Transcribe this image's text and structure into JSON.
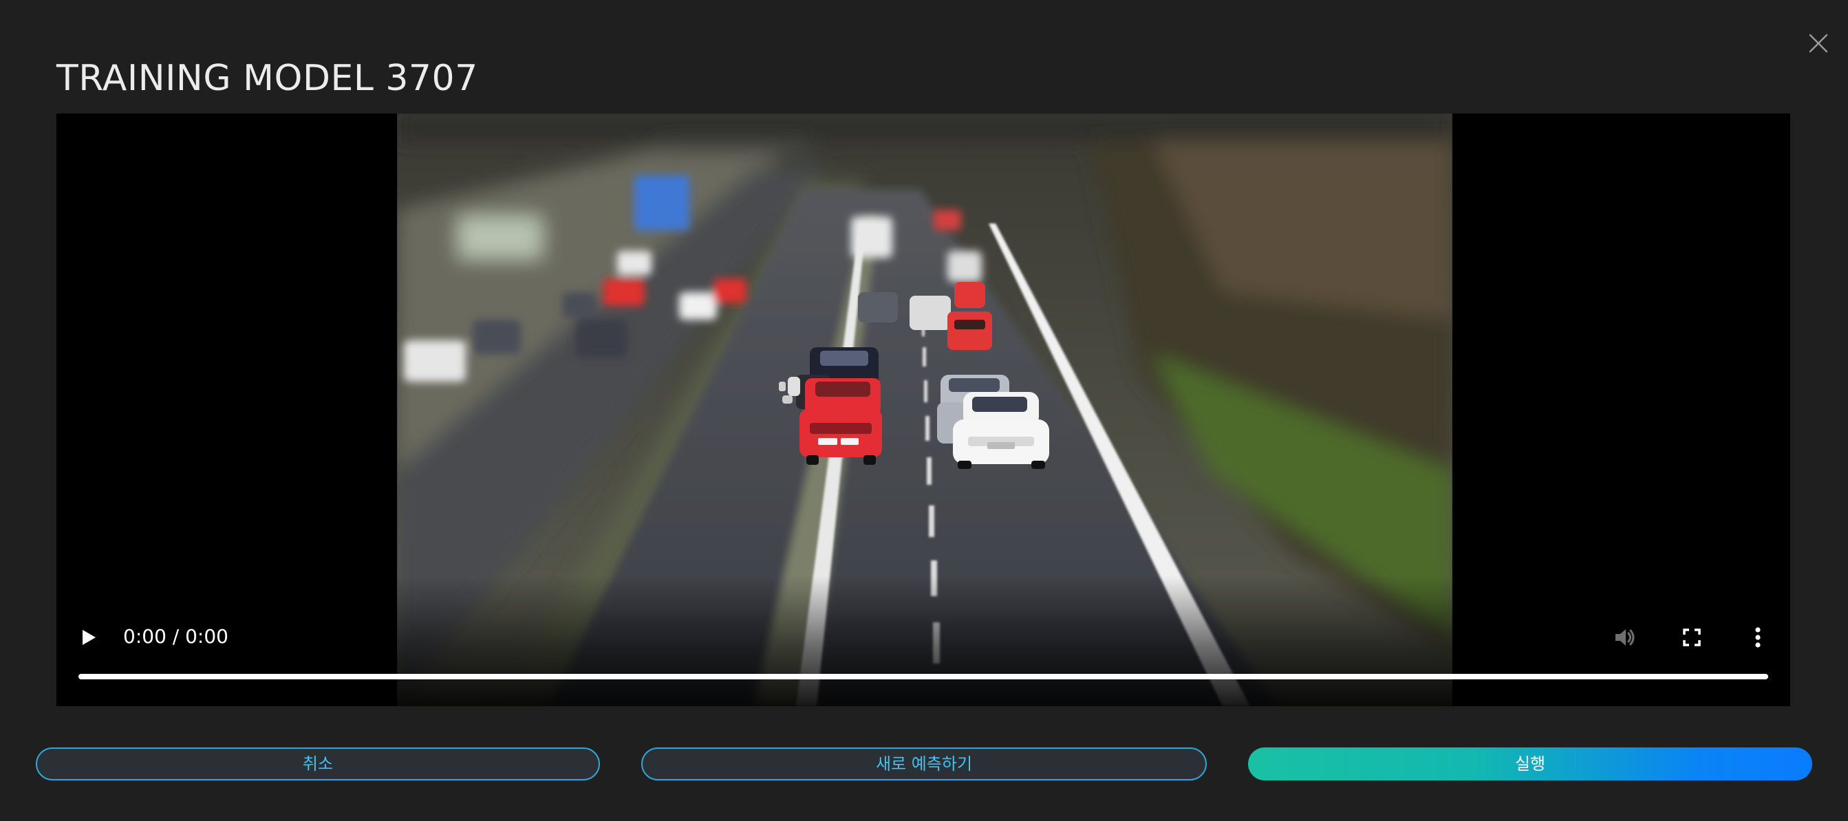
{
  "dialog": {
    "title": "TRAINING MODEL 3707"
  },
  "video": {
    "time_display": "0:00 / 0:00",
    "progress": 1.0,
    "icons": {
      "play": "play-icon",
      "mute": "volume-icon",
      "fullscreen": "fullscreen-icon",
      "more": "more-vertical-icon",
      "close": "close-icon"
    }
  },
  "actions": {
    "cancel_label": "취소",
    "new_predict_label": "새로 예측하기",
    "run_label": "실행"
  },
  "colors": {
    "background": "#1f1f1f",
    "outline_accent": "#2fa6d6",
    "run_gradient_start": "#1ac0a4",
    "run_gradient_end": "#0a7bff"
  }
}
